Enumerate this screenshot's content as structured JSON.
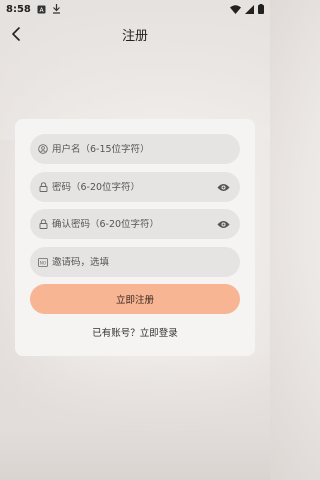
{
  "statusbar": {
    "time": "8:58",
    "icons": [
      "a-icon",
      "download-icon",
      "wifi-icon",
      "signal-icon",
      "battery-icon"
    ]
  },
  "header": {
    "title": "注册",
    "back_icon": "chevron-left-icon"
  },
  "form": {
    "username": {
      "placeholder": "用户名（6-15位字符）",
      "value": "",
      "icon": "user-icon"
    },
    "password": {
      "placeholder": "密码（6-20位字符）",
      "value": "",
      "icon": "lock-icon",
      "toggle_icon": "eye-icon"
    },
    "confirm_password": {
      "placeholder": "确认密码（6-20位字符）",
      "value": "",
      "icon": "lock-icon",
      "toggle_icon": "eye-icon"
    },
    "invite_code": {
      "placeholder": "邀请码，选填",
      "value": "",
      "icon": "code-icon"
    },
    "submit_label": "立即注册",
    "login_link": "已有账号？立即登录"
  },
  "colors": {
    "accent": "#f7b593",
    "field_bg": "#e6e4e3",
    "card_bg": "#f6f4f3"
  }
}
